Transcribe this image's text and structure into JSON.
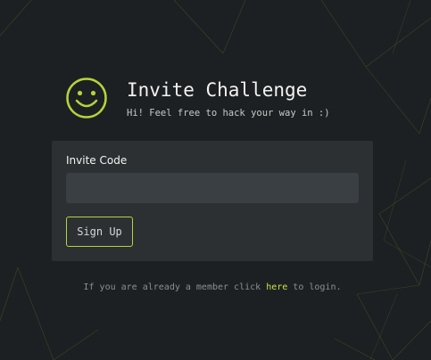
{
  "header": {
    "title": "Invite Challenge",
    "subtitle": "Hi! Feel free to hack your way in :)",
    "logo_icon": "smiley-face-icon"
  },
  "form": {
    "label": "Invite Code",
    "input_value": "",
    "input_placeholder": "",
    "submit_label": "Sign Up"
  },
  "footer": {
    "prefix": "If you are already a member click ",
    "link_label": "here",
    "suffix": " to login."
  },
  "colors": {
    "background": "#1d2022",
    "card": "#2c3033",
    "input": "#3a3f44",
    "accent": "#b5d33a",
    "link": "#c9e34a"
  }
}
